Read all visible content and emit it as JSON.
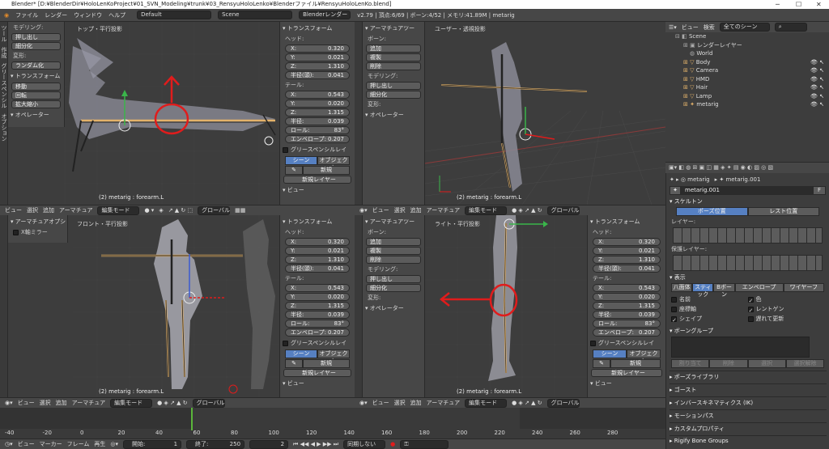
{
  "window": {
    "title": "Blender* [D:¥BlenderDir¥HoloLenKoProject¥01_SVN_Modeling¥trunk¥03_RensyuHoloLenko¥Blenderファイル¥RensyuHoloLenKo.blend]",
    "minimize": "─",
    "maximize": "☐",
    "close": "✕"
  },
  "menubar": {
    "items": [
      "ファイル",
      "レンダー",
      "ウィンドウ",
      "ヘルプ"
    ],
    "layout": "Default",
    "scene": "Scene",
    "engine": "Blenderレンダー",
    "stats": "v2.79 | 頂点:6/69 | ボーン:4/52 | メモリ:41.89M | metarig"
  },
  "tool_shelf": {
    "tabs": [
      "ツール",
      "作成",
      "グリースペンシル",
      "オプション"
    ],
    "modeling": "モデリング:",
    "btn_push": "押し出し",
    "btn_subdiv": "細分化",
    "deform": "変形:",
    "btn_randomize": "ランダム化",
    "transform": "▾ トランスフォーム",
    "btn_move": "移動",
    "btn_rotate": "回転",
    "btn_scale": "拡大縮小",
    "operator": "▾ オペレーター"
  },
  "vp_tl": {
    "title": "トップ・平行投影",
    "footer": "(2) metarig : forearm.L"
  },
  "vp_tr": {
    "title": "ユーザー・透視投影",
    "footer": "(2) metarig : forearm.L"
  },
  "vp_bl": {
    "title": "フロント・平行投影",
    "footer": "(2) metarig : forearm.L"
  },
  "vp_br": {
    "title": "ライト・平行投影",
    "footer": "(2) metarig : forearm.L"
  },
  "armature_tools": {
    "title": "▾ アーマチュアツー",
    "bone": "ボーン:",
    "add": "追加",
    "duplicate": "複製",
    "delete": "削除",
    "modeling": "モデリング:",
    "push": "押し出し",
    "subdiv": "細分化",
    "deform": "変形:",
    "operator": "▾ オペレーター"
  },
  "armature_options": {
    "title": "▾ アーマチュアオプシ",
    "xmirror": "X軸ミラー"
  },
  "npanel": {
    "transform": "▾ トランスフォーム",
    "head": "ヘッド:",
    "hx": "0.320",
    "hy": "0.021",
    "hz": "1.310",
    "radius_label": "半径(頭):",
    "radius_head": "0.041",
    "tail": "テール:",
    "tx": "0.543",
    "ty": "0.020",
    "tz": "1.315",
    "radius_tail_label": "半径:",
    "radius_tail": "0.039",
    "roll_label": "ロール:",
    "roll": "83°",
    "env_label": "エンベロープ:",
    "env": "0.207",
    "gp": "グリースペンシルレイ",
    "gp_scene": "シーン",
    "gp_object": "オブジェクト",
    "gp_new": "新規",
    "gp_newlayer": "新規レイヤー",
    "view": "▾ ビュー",
    "x": "X:",
    "y": "Y:",
    "z": "Z:"
  },
  "viewport_header": {
    "view": "ビュー",
    "select": "選択",
    "add": "追加",
    "armature": "アーマチュア",
    "mode": "編集モード",
    "orient": "グローバル"
  },
  "outliner": {
    "view": "ビュー",
    "search": "検索",
    "scenes": "全てのシーン",
    "items": [
      "Scene",
      "レンダーレイヤー",
      "World",
      "Body",
      "Camera",
      "HMD",
      "Hair",
      "Lamp",
      "metarig"
    ]
  },
  "properties": {
    "breadcrumb_obj": "metarig",
    "breadcrumb_data": "metarig.001",
    "name": "metarig.001",
    "skeleton": "▾ スケルトン",
    "pose_pos": "ポーズ位置",
    "rest_pos": "レスト位置",
    "layer": "レイヤー:",
    "protected": "保護レイヤー:",
    "display": "▾ 表示",
    "disp_opts": [
      "八面体",
      "スティック",
      "Bボーン",
      "エンベロープ",
      "ワイヤーフ"
    ],
    "names": "名前",
    "axes": "座標軸",
    "shape": "シェイプ",
    "colors": "色",
    "xray": "レントゲン",
    "delay": "遅れて更新",
    "bone_groups": "▾ ボーングループ",
    "assign": "割り当て",
    "remove": "削除",
    "select": "選択",
    "deselect": "選択解除",
    "collapsed": [
      "▸ ポーズライブラリ",
      "▸ ゴースト",
      "▸ インバースキネマティクス (IK)",
      "▸ モーションパス",
      "▸ カスタムプロパティ",
      "▸ Rigify Bone Groups"
    ]
  },
  "timeline": {
    "ticks": [
      "-40",
      "-20",
      "0",
      "20",
      "40",
      "60",
      "80",
      "100",
      "120",
      "140",
      "160",
      "180",
      "200",
      "220",
      "240",
      "260",
      "280"
    ],
    "view": "ビュー",
    "marker": "マーカー",
    "frame": "フレーム",
    "playback": "再生",
    "start": "開始:",
    "start_val": "1",
    "end": "終了:",
    "end_val": "250",
    "current": "2",
    "sync": "同期しない"
  },
  "colors": {
    "accent": "#5680c2",
    "bone": "#e3b26a",
    "annotation": "#e01c1c"
  }
}
